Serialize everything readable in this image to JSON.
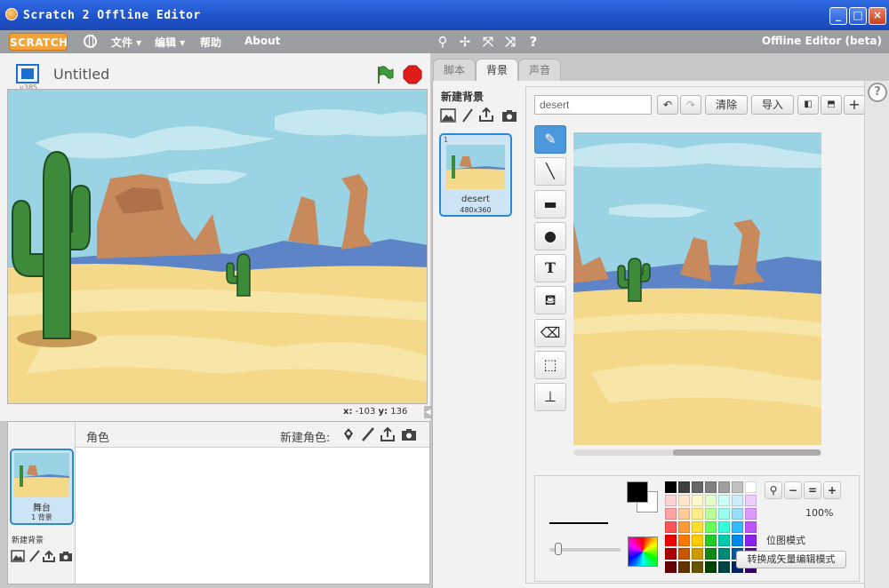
{
  "window": {
    "title": "Scratch 2 Offline Editor",
    "buttons": {
      "minimize": "_",
      "maximize": "□",
      "close": "×"
    }
  },
  "menubar": {
    "logo": "SCRATCH",
    "items": [
      "文件 ▾",
      "编辑 ▾",
      "帮助",
      "About"
    ],
    "version": "Offline Editor (beta)",
    "tools": [
      "duplicate-icon",
      "delete-icon",
      "grow-icon",
      "shrink-icon",
      "help-icon"
    ]
  },
  "stage": {
    "version": "v385",
    "project_title": "Untitled",
    "coords": {
      "x_label": "x:",
      "x": "-103",
      "y_label": "y:",
      "y": "136"
    }
  },
  "sprites": {
    "header_label": "角色",
    "new_sprite_label": "新建角色:",
    "stage_name": "舞台",
    "stage_count": "1 背景",
    "new_backdrop_label": "新建背景"
  },
  "tabs": [
    {
      "label": "脚本",
      "active": false
    },
    {
      "label": "背景",
      "active": true
    },
    {
      "label": "声音",
      "active": false
    }
  ],
  "editor": {
    "new_backdrop_title": "新建背景",
    "backdrop": {
      "index": "1",
      "name": "desert",
      "dims": "480x360"
    },
    "name_value": "desert",
    "clear_label": "清除",
    "import_label": "导入",
    "zoom_level": "100%",
    "mode_label": "位图模式",
    "convert_label": "转换成矢量编辑模式",
    "tools": [
      "brush-icon",
      "line-icon",
      "rectangle-icon",
      "ellipse-icon",
      "text-icon",
      "fill-icon",
      "eraser-icon",
      "select-icon",
      "stamp-icon"
    ]
  },
  "colors": {
    "accent": "#4d97dd",
    "sky": "#9ad3e3",
    "sand": "#f4d98a",
    "cactus": "#3d8a3a",
    "rock": "#c88a5c",
    "flag": "#3d9b3d",
    "stop": "#e11c1c"
  },
  "palette": [
    "#000000",
    "#404040",
    "#666666",
    "#808080",
    "#a0a0a0",
    "#c0c0c0",
    "#ffffff",
    "#fbd3d3",
    "#ffe5cc",
    "#fff8cc",
    "#e5ffcc",
    "#ccfff5",
    "#ccecff",
    "#eeccff",
    "#ffa3a3",
    "#ffcc99",
    "#ffee88",
    "#bbff99",
    "#99ffee",
    "#99ddff",
    "#dd99ff",
    "#ff5555",
    "#ff9933",
    "#ffdd33",
    "#66ff55",
    "#33ffdd",
    "#33bbff",
    "#bb55ff",
    "#ee0000",
    "#ff7700",
    "#ffcc00",
    "#22cc22",
    "#00ccaa",
    "#0088ee",
    "#8822ee",
    "#aa0000",
    "#cc5500",
    "#cc9900",
    "#118811",
    "#008877",
    "#0055aa",
    "#551199",
    "#660000",
    "#663300",
    "#665500",
    "#004400",
    "#004444",
    "#002266",
    "#330066"
  ]
}
